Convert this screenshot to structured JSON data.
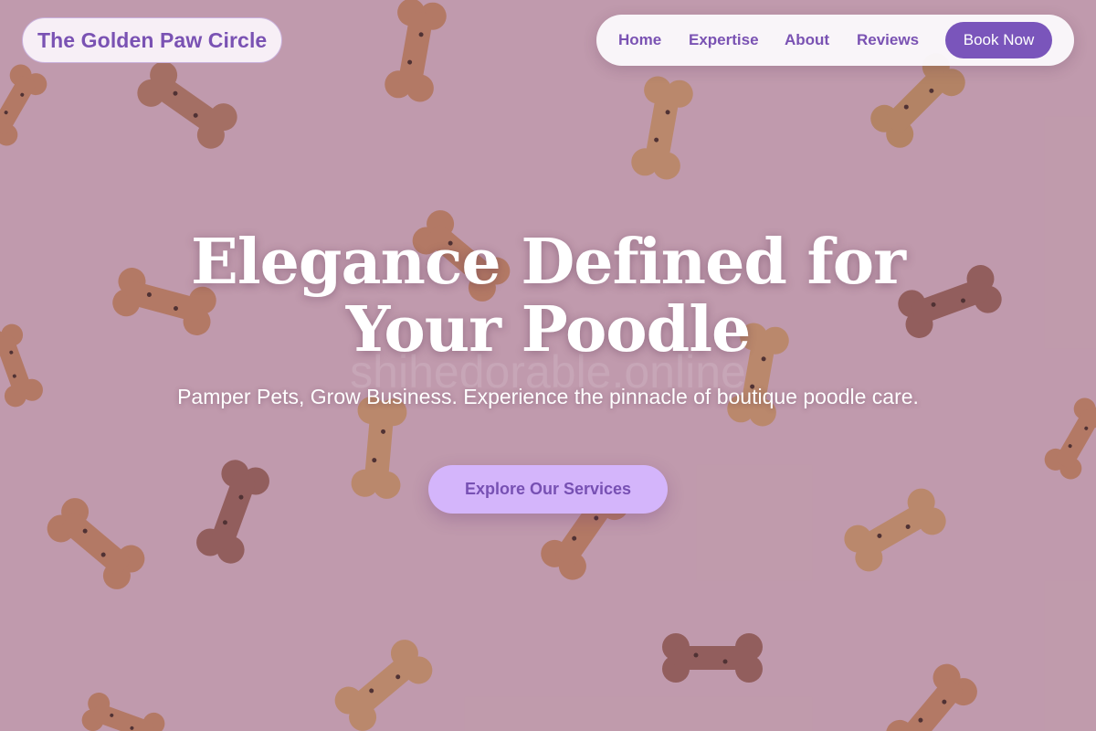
{
  "brand": {
    "name": "The Golden Paw Circle"
  },
  "nav": {
    "links": [
      {
        "label": "Home"
      },
      {
        "label": "Expertise"
      },
      {
        "label": "About"
      },
      {
        "label": "Reviews"
      }
    ],
    "cta_label": "Book Now"
  },
  "hero": {
    "headline_line1": "Elegance Defined for",
    "headline_line2": "Your Poodle",
    "watermark": "shihedorable.online",
    "subtitle": "Pamper Pets, Grow Business. Experience the pinnacle of boutique poodle care.",
    "cta_label": "Explore Our Services",
    "background_image": "dog-biscuit-bones-pattern"
  },
  "colors": {
    "accent": "#7a55bb",
    "cta_bg": "#d4b5fb",
    "bg_pink": "#c8a6b3"
  }
}
